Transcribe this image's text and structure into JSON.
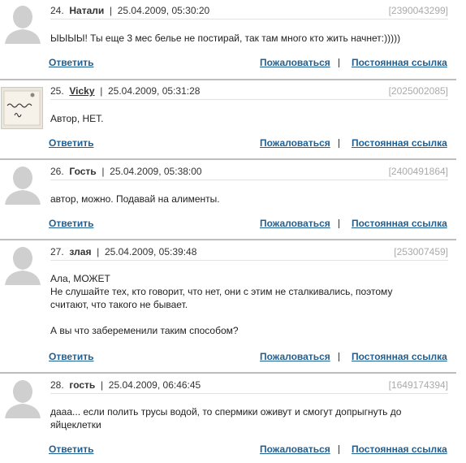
{
  "comments": [
    {
      "number": "24.",
      "nick": "Натали",
      "date": "25.04.2009, 05:30:20",
      "post_id": "[2390043299]",
      "lines": [
        "ЫЫЫЫ! Ты еще 3 мес белье не постирай, так там много кто жить начнет:)))))"
      ],
      "avatar": "default-silhouette"
    },
    {
      "number": "25.",
      "nick": "Vicky",
      "date": "25.04.2009, 05:31:28",
      "post_id": "[2025002085]",
      "lines": [
        "Автор, НЕТ."
      ],
      "avatar": "handwritten-note",
      "avatar_text": [
        "Здесь была",
        "Я."
      ]
    },
    {
      "number": "26.",
      "nick": "Гость",
      "date": "25.04.2009, 05:38:00",
      "post_id": "[2400491864]",
      "lines": [
        "автор, можно. Подавай на алименты."
      ],
      "avatar": "default-silhouette"
    },
    {
      "number": "27.",
      "nick": "злая",
      "date": "25.04.2009, 05:39:48",
      "post_id": "[253007459]",
      "lines": [
        "Ала, МОЖЕТ",
        "Не слушайте тех, кто говорит, что нет, они с этим не сталкивались, поэтому",
        "считают, что такого не бывает.",
        "",
        "А вы что забеременили таким способом?"
      ],
      "avatar": "default-silhouette"
    },
    {
      "number": "28.",
      "nick": "гость",
      "date": "25.04.2009, 06:46:45",
      "post_id": "[1649174394]",
      "lines": [
        "дааа... если полить трусы водой, то спермики оживут и смогут допрыгнуть до",
        "яйцеклетки"
      ],
      "avatar": "default-silhouette"
    }
  ],
  "actions": {
    "reply": "Ответить",
    "complain": "Пожаловаться",
    "separator": "|",
    "permalink": "Постоянная ссылка"
  },
  "colors": {
    "link": "#1f5f93",
    "post_id": "#aaaaaa",
    "separator": "#bdbdbd",
    "avatar_silhouette": "#cfcfcf"
  }
}
